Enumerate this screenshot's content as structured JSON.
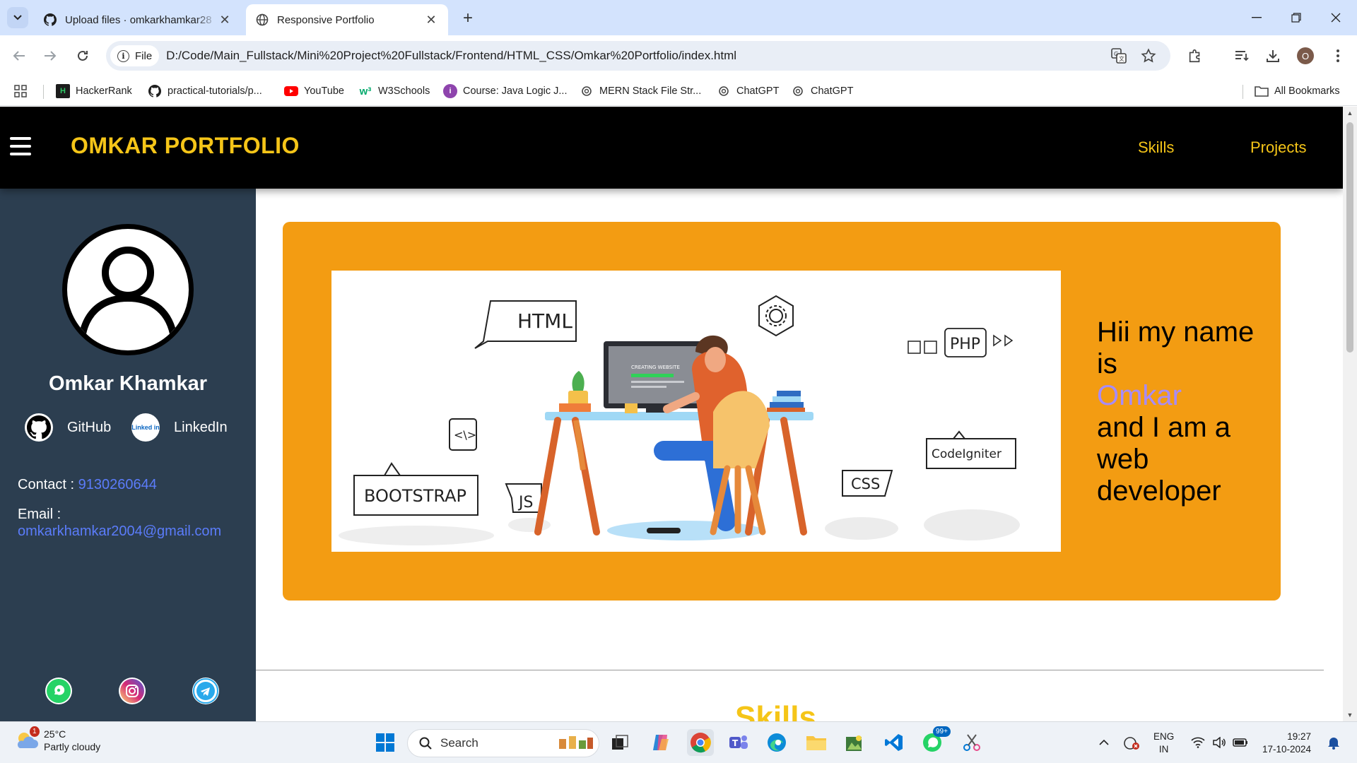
{
  "browser": {
    "tabs": [
      {
        "title": "Upload files · omkarkhamkar28",
        "active": false
      },
      {
        "title": "Responsive Portfolio",
        "active": true
      }
    ],
    "site_chip": "File",
    "url": "D:/Code/Main_Fullstack/Mini%20Project%20Fullstack/Frontend/HTML_CSS/Omkar%20Portfolio/index.html",
    "profile_initial": "O",
    "bookmarks": [
      "HackerRank",
      "practical-tutorials/p...",
      "YouTube",
      "W3Schools",
      "Course: Java Logic J...",
      "MERN Stack File Str...",
      "ChatGPT",
      "ChatGPT"
    ],
    "all_bookmarks": "All Bookmarks"
  },
  "site": {
    "brand": "OMKAR PORTFOLIO",
    "nav": [
      "Skills",
      "Projects"
    ],
    "sidebar": {
      "name": "Omkar Khamkar",
      "github_label": "GitHub",
      "linkedin_label": "LinkedIn",
      "linkedin_logo": "Linked in",
      "contact_label": "Contact : ",
      "contact_value": "9130260644",
      "email_label": "Email :",
      "email_value": "omkarkhamkar2004@gmail.com"
    },
    "hero": {
      "line1": "Hii my name is",
      "highlight": "Omkar",
      "line2": "and I am a web developer",
      "illustration_labels": {
        "html": "HTML",
        "php": "PHP",
        "bootstrap": "BOOTSTRAP",
        "js": "JS",
        "css": "CSS",
        "codeigniter": "CodeIgniter",
        "screen": "CREATING WEBSITE"
      }
    },
    "skills_heading": "Skills"
  },
  "taskbar": {
    "weather_temp": "25°C",
    "weather_desc": "Partly cloudy",
    "weather_badge": "1",
    "search_placeholder": "Search",
    "whatsapp_badge": "99+",
    "lang_top": "ENG",
    "lang_bottom": "IN",
    "time": "19:27",
    "date": "17-10-2024"
  },
  "colors": {
    "header_bg": "#000000",
    "brand_yellow": "#f5c518",
    "sidebar_bg": "#2c3e50",
    "hero_orange": "#f39c12",
    "link_blue": "#5b7cfa",
    "highlight_purple": "#a78bfa"
  }
}
